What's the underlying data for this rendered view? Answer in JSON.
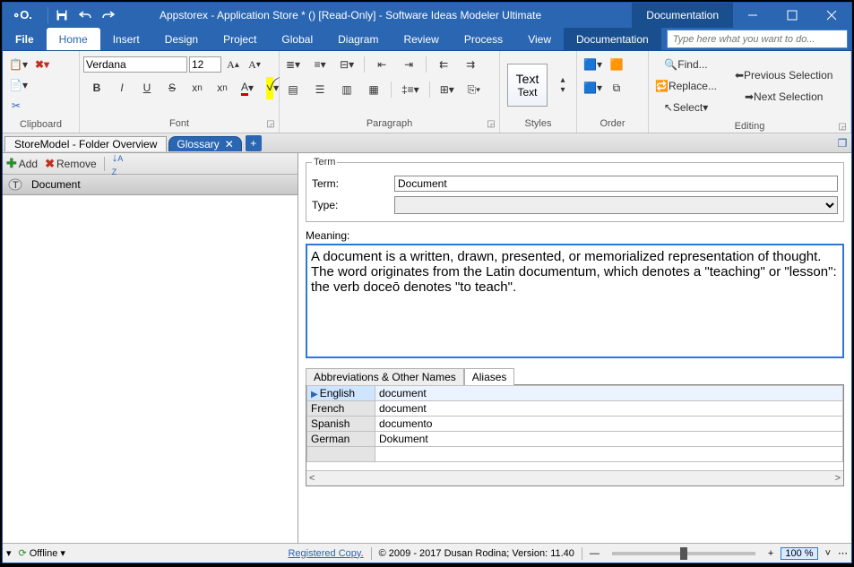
{
  "titlebar": {
    "title": "Appstorex - Application Store * () [Read-Only] - Software Ideas Modeler Ultimate",
    "doc_tab": "Documentation"
  },
  "menu": {
    "file": "File",
    "home": "Home",
    "insert": "Insert",
    "design": "Design",
    "project": "Project",
    "global": "Global",
    "diagram": "Diagram",
    "review": "Review",
    "process": "Process",
    "view": "View",
    "documentation": "Documentation",
    "search_placeholder": "Type here what you want to do..."
  },
  "ribbon": {
    "clipboard": {
      "label": "Clipboard"
    },
    "font": {
      "label": "Font",
      "family": "Verdana",
      "size": "12"
    },
    "paragraph": {
      "label": "Paragraph"
    },
    "styles": {
      "label": "Styles",
      "text_big": "Text",
      "text_small": "Text"
    },
    "order": {
      "label": "Order"
    },
    "editing": {
      "label": "Editing",
      "find": "Find...",
      "replace": "Replace...",
      "select": "Select",
      "prev_sel": "Previous Selection",
      "next_sel": "Next Selection"
    }
  },
  "tabs": {
    "t1": "StoreModel - Folder Overview",
    "t2": "Glossary"
  },
  "sidebar": {
    "add": "Add",
    "remove": "Remove",
    "item0": "Document"
  },
  "term": {
    "legend": "Term",
    "term_label": "Term:",
    "term_value": "Document",
    "type_label": "Type:",
    "type_value": "",
    "meaning_label": "Meaning:",
    "meaning_value": "A document is a written, drawn, presented, or memorialized representation of thought. The word originates from the Latin documentum, which denotes a \"teaching\" or \"lesson\": the verb doceō denotes \"to teach\"."
  },
  "alias_tabs": {
    "abbr": "Abbreviations & Other Names",
    "aliases": "Aliases"
  },
  "aliases": [
    {
      "lang": "English",
      "val": "document"
    },
    {
      "lang": "French",
      "val": "document"
    },
    {
      "lang": "Spanish",
      "val": "documento"
    },
    {
      "lang": "German",
      "val": "Dokument"
    }
  ],
  "status": {
    "offline": "Offline",
    "registered": "Registered Copy.",
    "copyright": "© 2009 - 2017 Dusan Rodina; Version: 11.40",
    "zoom": "100 %"
  }
}
